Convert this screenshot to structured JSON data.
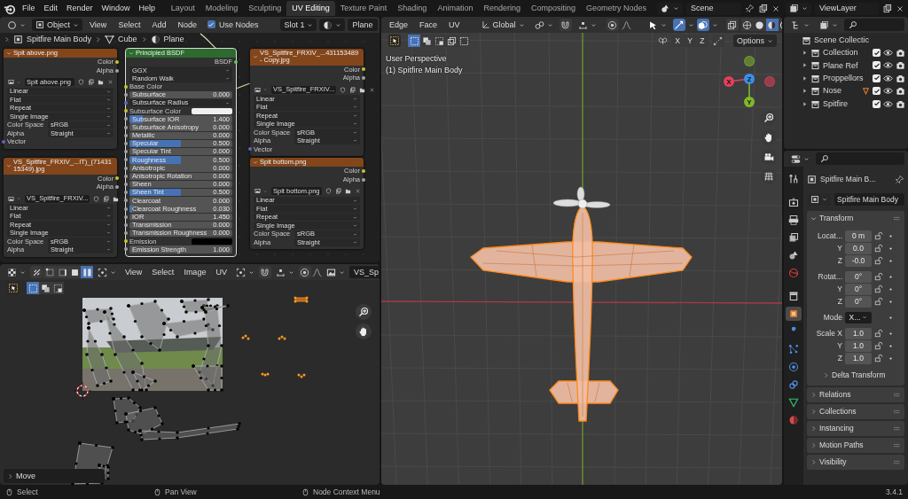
{
  "topbar": {
    "menus": [
      "File",
      "Edit",
      "Render",
      "Window",
      "Help"
    ],
    "workspaces": [
      {
        "label": "Layout",
        "selected": false
      },
      {
        "label": "Modeling",
        "selected": false
      },
      {
        "label": "Sculpting",
        "selected": false
      },
      {
        "label": "UV Editing",
        "selected": true
      },
      {
        "label": "Texture Paint",
        "selected": false
      },
      {
        "label": "Shading",
        "selected": false
      },
      {
        "label": "Animation",
        "selected": false
      },
      {
        "label": "Rendering",
        "selected": false
      },
      {
        "label": "Compositing",
        "selected": false
      },
      {
        "label": "Geometry Nodes",
        "selected": false
      }
    ],
    "scene": "Scene",
    "view_layer": "ViewLayer"
  },
  "node_editor": {
    "mode": "Object",
    "menus": [
      "View",
      "Select",
      "Add",
      "Node"
    ],
    "use_nodes": {
      "label": "Use Nodes",
      "checked": true
    },
    "slot": "Slot 1",
    "material": "Plane",
    "breadcrumbs": [
      "Spitfire Main Body",
      "Cube",
      "Plane"
    ],
    "image_nodes": [
      {
        "title": "Spit above.png",
        "outputs": [
          "Color",
          "Alpha"
        ],
        "image": "Spit above.png",
        "options": [
          "Linear",
          "Flat",
          "Repeat",
          "Single Image"
        ],
        "color_space": {
          "label": "Color Space",
          "value": "sRGB"
        },
        "alpha": {
          "label": "Alpha",
          "value": "Straight"
        },
        "input": "Vector"
      },
      {
        "title": "VS_Spitfire_FRXIV_...431153489 - Copy.jpg",
        "outputs": [
          "Color",
          "Alpha"
        ],
        "image": "VS_Spitfire_FRXIV...",
        "options": [
          "Linear",
          "Flat",
          "Repeat",
          "Single Image"
        ],
        "color_space": {
          "label": "Color Space",
          "value": "sRGB"
        },
        "alpha": {
          "label": "Alpha",
          "value": "Straight"
        },
        "input": "Vector"
      },
      {
        "title": "VS_Spitfire_FRXIV_...IT)_(7143115349).jpg",
        "outputs": [
          "Color",
          "Alpha"
        ],
        "image": "VS_Spitfire_FRXIV...",
        "options": [
          "Linear",
          "Flat",
          "Repeat",
          "Single Image"
        ],
        "color_space": {
          "label": "Color Space",
          "value": "sRGB"
        },
        "alpha": {
          "label": "Alpha",
          "value": "Straight"
        }
      },
      {
        "title": "Spit bottom.png",
        "outputs": [
          "Color",
          "Alpha"
        ],
        "image": "Spit bottom.png",
        "options": [
          "Linear",
          "Flat",
          "Repeat",
          "Single Image"
        ],
        "color_space": {
          "label": "Color Space",
          "value": "sRGB"
        },
        "alpha": {
          "label": "Alpha",
          "value": "Straight"
        }
      }
    ],
    "bsdf": {
      "title": "Principled BSDF",
      "output": "BSDF",
      "rows": [
        {
          "kind": "dropdown",
          "label": "GGX"
        },
        {
          "kind": "dropdown",
          "label": "Random Walk"
        },
        {
          "kind": "color-input",
          "label": "Base Color"
        },
        {
          "kind": "slider",
          "label": "Subsurface",
          "value": "0.000",
          "level": 0
        },
        {
          "kind": "vector",
          "label": "Subsurface Radius"
        },
        {
          "kind": "color",
          "label": "Subsurface Color",
          "color": "#f0f0f0"
        },
        {
          "kind": "slider",
          "label": "Subsurface IOR",
          "value": "1.400",
          "level": 0.13
        },
        {
          "kind": "slider",
          "label": "Subsurface Anisotropy",
          "value": "0.000",
          "level": 0
        },
        {
          "kind": "slider",
          "label": "Metallic",
          "value": "0.000",
          "level": 0
        },
        {
          "kind": "slider",
          "label": "Specular",
          "value": "0.500",
          "level": 0.5
        },
        {
          "kind": "slider",
          "label": "Specular Tint",
          "value": "0.000",
          "level": 0
        },
        {
          "kind": "slider",
          "label": "Roughness",
          "value": "0.500",
          "level": 0.5
        },
        {
          "kind": "slider",
          "label": "Anisotropic",
          "value": "0.000",
          "level": 0
        },
        {
          "kind": "slider",
          "label": "Anisotropic Rotation",
          "value": "0.000",
          "level": 0
        },
        {
          "kind": "slider",
          "label": "Sheen",
          "value": "0.000",
          "level": 0
        },
        {
          "kind": "slider",
          "label": "Sheen Tint",
          "value": "0.500",
          "level": 0.5
        },
        {
          "kind": "slider",
          "label": "Clearcoat",
          "value": "0.000",
          "level": 0
        },
        {
          "kind": "slider",
          "label": "Clearcoat Roughness",
          "value": "0.030",
          "level": 0.03
        },
        {
          "kind": "slider",
          "label": "IOR",
          "value": "1.450",
          "level": 0
        },
        {
          "kind": "slider",
          "label": "Transmission",
          "value": "0.000",
          "level": 0
        },
        {
          "kind": "slider",
          "label": "Transmission Roughness",
          "value": "0.000",
          "level": 0
        },
        {
          "kind": "color",
          "label": "Emission",
          "color": "#000000"
        },
        {
          "kind": "slider",
          "label": "Emission Strength",
          "value": "1.000",
          "level": 0
        }
      ]
    }
  },
  "uv_editor": {
    "menus": [
      "View",
      "Select",
      "Image",
      "UV"
    ],
    "select_modes": [
      {
        "selected": false
      },
      {
        "selected": false
      },
      {
        "selected": false
      },
      {
        "selected": true
      }
    ],
    "image": "VS_Sp",
    "operator_panel": {
      "label": "Move",
      "expanded": false
    }
  },
  "viewport": {
    "menus": [
      "Edge",
      "Face",
      "UV"
    ],
    "orientation": "Global",
    "shading_modes": [
      {
        "selected": false
      },
      {
        "selected": false
      },
      {
        "selected": true
      },
      {
        "selected": false
      }
    ],
    "axis_toggles": [
      "X",
      "Y",
      "Z"
    ],
    "options": "Options",
    "overlay_lines": [
      "User Perspective",
      "(1) Spitfire Main Body"
    ],
    "gizmo": [
      {
        "label": "X",
        "color": "#e2405a"
      },
      {
        "label": "Z",
        "color": "#3b8fe6"
      },
      {
        "label": "Y",
        "color": "#80b72a"
      }
    ]
  },
  "outliner": {
    "root": "Scene Collectic",
    "items": [
      {
        "label": "Collection",
        "kind": "plain",
        "checked": true
      },
      {
        "label": "Plane Ref",
        "kind": "plain",
        "checked": true
      },
      {
        "label": "Proppellors",
        "kind": "plain",
        "checked": true
      },
      {
        "label": "Nose",
        "kind": "marked",
        "checked": true
      },
      {
        "label": "Spitfire",
        "kind": "plain",
        "checked": true
      }
    ]
  },
  "properties": {
    "tabs": [
      {
        "selected": false
      },
      {
        "selected": false
      },
      {
        "selected": false
      },
      {
        "selected": false
      },
      {
        "selected": false
      },
      {
        "selected": false
      },
      {
        "selected": false
      },
      {
        "selected": true
      },
      {
        "selected": false
      },
      {
        "selected": false
      },
      {
        "selected": false
      },
      {
        "selected": false
      },
      {
        "selected": false
      },
      {
        "selected": false
      }
    ],
    "object_name": "Spitfire Main B...",
    "data_name": "Spitfire Main Body",
    "panels": [
      {
        "title": "Transform",
        "expanded": true,
        "groups": [
          [
            {
              "kind": "number",
              "label": "Locat...",
              "value": "0 m"
            },
            {
              "kind": "number",
              "label": "Y",
              "value": "0.0"
            },
            {
              "kind": "number",
              "label": "Z",
              "value": "-0.0"
            }
          ],
          [
            {
              "kind": "number",
              "label": "Rotat...",
              "value": "0°"
            },
            {
              "kind": "number",
              "label": "Y",
              "value": "0°"
            },
            {
              "kind": "number",
              "label": "Z",
              "value": "0°"
            }
          ],
          [
            {
              "kind": "dropdown",
              "label": "Mode",
              "value": "X..."
            }
          ],
          [
            {
              "kind": "number",
              "label": "Scale X",
              "value": "1.0"
            },
            {
              "kind": "number",
              "label": "Y",
              "value": "1.0"
            },
            {
              "kind": "number",
              "label": "Z",
              "value": "1.0"
            }
          ]
        ],
        "subpanel": {
          "title": "Delta Transform",
          "expanded": false
        }
      },
      {
        "title": "Relations",
        "expanded": false
      },
      {
        "title": "Collections",
        "expanded": false
      },
      {
        "title": "Instancing",
        "expanded": false
      },
      {
        "title": "Motion Paths",
        "expanded": false
      },
      {
        "title": "Visibility",
        "expanded": false
      }
    ]
  },
  "status_bar": {
    "items": [
      "Select",
      "Pan View",
      "Node Context Menu"
    ],
    "version": "3.4.1"
  }
}
